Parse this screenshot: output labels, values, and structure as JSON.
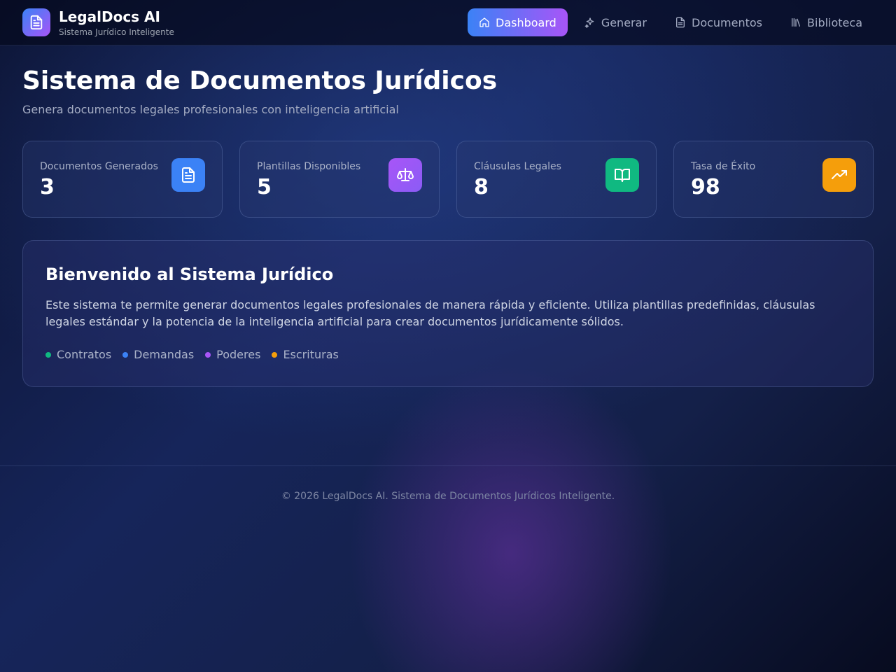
{
  "header": {
    "brand_name": "LegalDocs AI",
    "brand_tagline": "Sistema Jurídico Inteligente",
    "logo_icon": "file-text-icon",
    "nav": [
      {
        "label": "Dashboard",
        "icon": "home-icon",
        "active": true
      },
      {
        "label": "Generar",
        "icon": "sparkles-icon",
        "active": false
      },
      {
        "label": "Documentos",
        "icon": "file-icon",
        "active": false
      },
      {
        "label": "Biblioteca",
        "icon": "library-icon",
        "active": false
      }
    ]
  },
  "main": {
    "title": "Sistema de Documentos Jurídicos",
    "subtitle": "Genera documentos legales profesionales con inteligencia artificial",
    "stats": [
      {
        "label": "Documentos Generados",
        "value": "3",
        "icon": "file-text-icon",
        "color": "#3b82f6"
      },
      {
        "label": "Plantillas Disponibles",
        "value": "5",
        "icon": "scale-icon",
        "color": "#a855f7"
      },
      {
        "label": "Cláusulas Legales",
        "value": "8",
        "icon": "book-open-icon",
        "color": "#10b981"
      },
      {
        "label": "Tasa de Éxito",
        "value": "98",
        "icon": "trending-up-icon",
        "color": "#f59e0b"
      }
    ],
    "welcome": {
      "title": "Bienvenido al Sistema Jurídico",
      "text": "Este sistema te permite generar documentos legales profesionales de manera rápida y eficiente. Utiliza plantillas predefinidas, cláusulas legales estándar y la potencia de la inteligencia artificial para crear documentos jurídicamente sólidos.",
      "tags": [
        {
          "label": "Contratos",
          "color": "#10b981"
        },
        {
          "label": "Demandas",
          "color": "#3b82f6"
        },
        {
          "label": "Poderes",
          "color": "#a855f7"
        },
        {
          "label": "Escrituras",
          "color": "#f59e0b"
        }
      ]
    }
  },
  "footer": {
    "text": "© 2026 LegalDocs AI. Sistema de Documentos Jurídicos Inteligente."
  }
}
